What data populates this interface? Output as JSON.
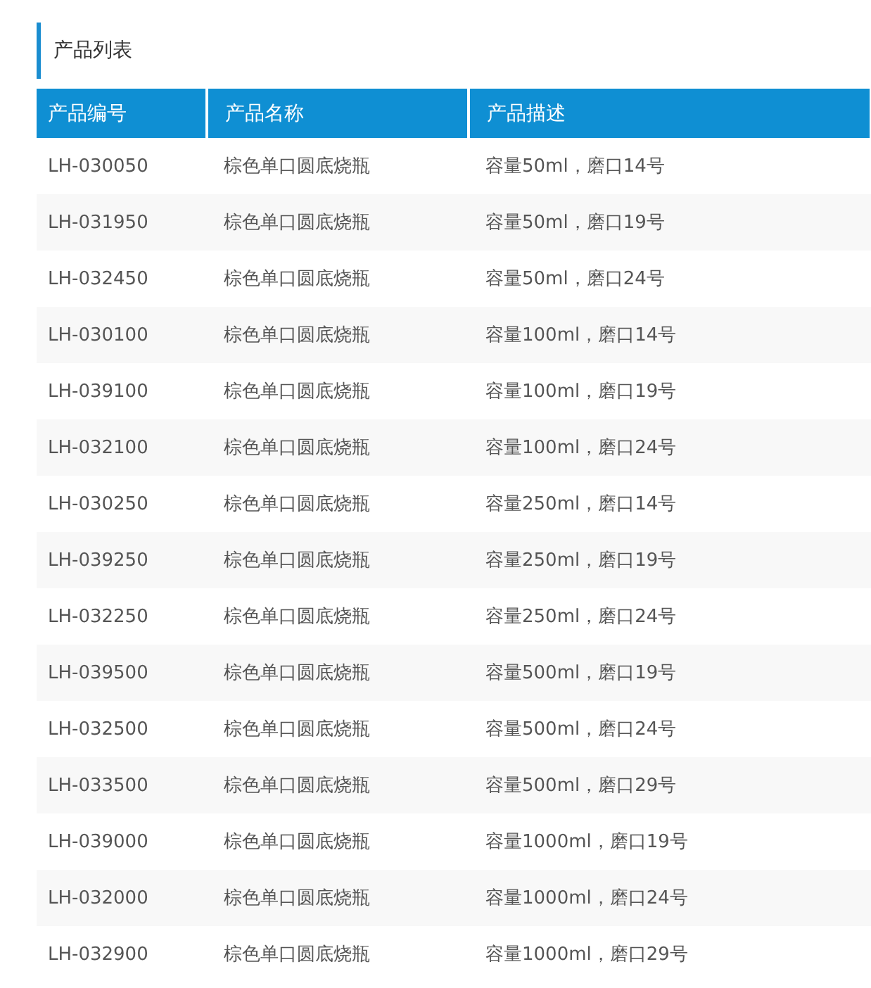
{
  "section": {
    "title": "产品列表"
  },
  "table": {
    "columns": [
      "产品编号",
      "产品名称",
      "产品描述"
    ],
    "rows": [
      [
        "LH-030050",
        "棕色单口圆底烧瓶",
        "容量50ml，磨口14号"
      ],
      [
        "LH-031950",
        "棕色单口圆底烧瓶",
        "容量50ml，磨口19号"
      ],
      [
        "LH-032450",
        "棕色单口圆底烧瓶",
        "容量50ml，磨口24号"
      ],
      [
        "LH-030100",
        "棕色单口圆底烧瓶",
        "容量100ml，磨口14号"
      ],
      [
        "LH-039100",
        "棕色单口圆底烧瓶",
        "容量100ml，磨口19号"
      ],
      [
        "LH-032100",
        "棕色单口圆底烧瓶",
        "容量100ml，磨口24号"
      ],
      [
        "LH-030250",
        "棕色单口圆底烧瓶",
        "容量250ml，磨口14号"
      ],
      [
        "LH-039250",
        "棕色单口圆底烧瓶",
        "容量250ml，磨口19号"
      ],
      [
        "LH-032250",
        "棕色单口圆底烧瓶",
        "容量250ml，磨口24号"
      ],
      [
        "LH-039500",
        "棕色单口圆底烧瓶",
        "容量500ml，磨口19号"
      ],
      [
        "LH-032500",
        "棕色单口圆底烧瓶",
        "容量500ml，磨口24号"
      ],
      [
        "LH-033500",
        "棕色单口圆底烧瓶",
        "容量500ml，磨口29号"
      ],
      [
        "LH-039000",
        "棕色单口圆底烧瓶",
        "容量1000ml，磨口19号"
      ],
      [
        "LH-032000",
        "棕色单口圆底烧瓶",
        "容量1000ml，磨口24号"
      ],
      [
        "LH-032900",
        "棕色单口圆底烧瓶",
        "容量1000ml，磨口29号"
      ]
    ]
  }
}
